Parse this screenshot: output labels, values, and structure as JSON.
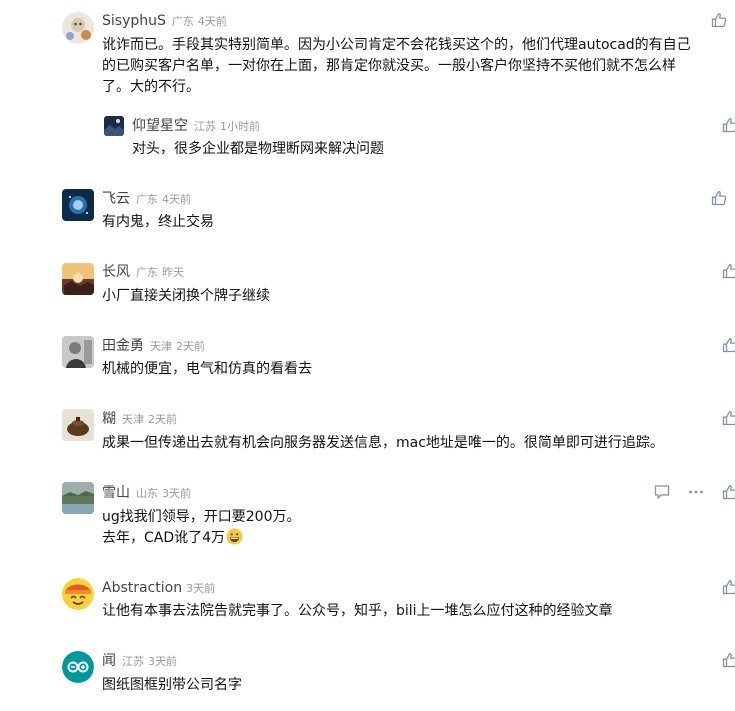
{
  "comments": [
    {
      "name": "SisyphuS",
      "location": "广东",
      "time": "4天前",
      "lines": [
        "讹诈而已。手段其实特别简单。因为小公司肯定不会花钱买这个的，他们代理autocad的有自己",
        "的已购买客户名单，一对你在上面，那肯定你就没买。一般小客户你坚持不买他们就不怎么样",
        "了。大的不行。"
      ],
      "reply": {
        "name": "仰望星空",
        "location": "江苏",
        "time": "1小时前",
        "text": "对头，很多企业都是物理断网来解决问题"
      }
    },
    {
      "name": "飞云",
      "location": "广东",
      "time": "4天前",
      "text": "有内鬼，终止交易"
    },
    {
      "name": "长风",
      "location": "广东",
      "time": "昨天",
      "text": "小厂直接关闭换个牌子继续"
    },
    {
      "name": "田金勇",
      "location": "天津",
      "time": "2天前",
      "text": "机械的便宜，电气和仿真的看看去"
    },
    {
      "name": "糊",
      "location": "天津",
      "time": "2天前",
      "text": "成果一但传递出去就有机会向服务器发送信息，mac地址是唯一的。很简单即可进行追踪。"
    },
    {
      "name": "雪山",
      "location": "山东",
      "time": "3天前",
      "line1": "ug找我们领导，开口要200万。",
      "line2": "去年，CAD讹了4万"
    },
    {
      "name": "Abstraction",
      "time": "3天前",
      "text": "让他有本事去法院告就完事了。公众号，知乎，bili上一堆怎么应付这种的经验文章"
    },
    {
      "name": "闻",
      "location": "江苏",
      "time": "3天前",
      "text": "图纸图框别带公司名字"
    }
  ],
  "icons": {
    "like": "thumbs-up-icon",
    "reply": "comment-bubble-icon",
    "more": "more-dots-icon",
    "emoji": "grinning-face-emoji"
  },
  "colors": {
    "text": "#121212",
    "name": "#444444",
    "meta": "#999999",
    "icon": "#8590a6"
  }
}
